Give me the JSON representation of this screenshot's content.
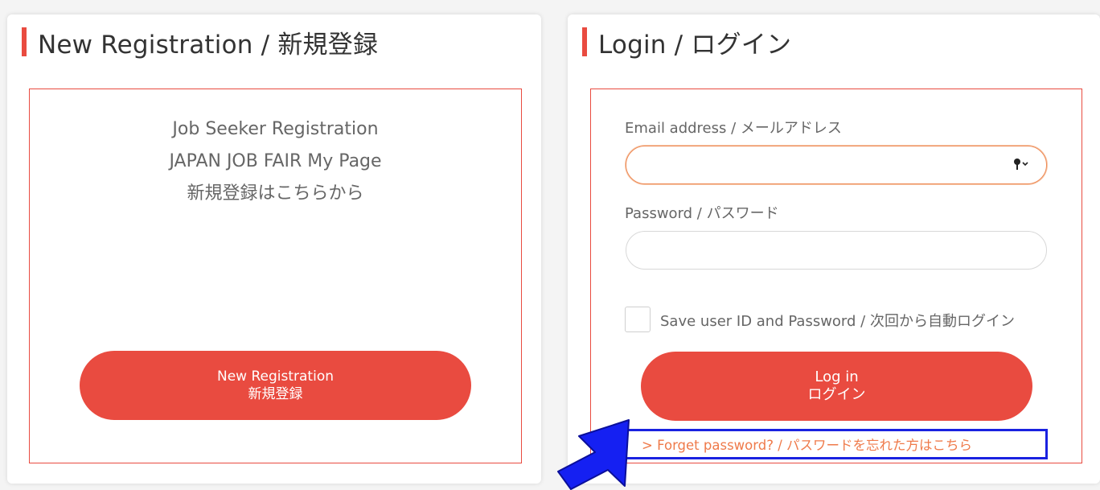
{
  "registration": {
    "title": "New Registration / 新規登録",
    "intro_line1": "Job Seeker Registration",
    "intro_line2": "JAPAN JOB FAIR My Page",
    "intro_line3": "新規登録はこちらから",
    "button_line1": "New Registration",
    "button_line2": "新規登録"
  },
  "login": {
    "title": "Login / ログイン",
    "email_label": "Email address / メールアドレス",
    "email_value": "",
    "password_label": "Password / パスワード",
    "password_value": "",
    "remember_label": "Save user ID and Password / 次回から自動ログイン",
    "remember_checked": false,
    "button_line1": "Log in",
    "button_line2": "ログイン",
    "forgot_link": "> Forget password? / パスワードを忘れた方はこちら"
  },
  "icons": {
    "email_field_icon": "key-icon",
    "pointer": "blue-arrow-icon"
  },
  "colors": {
    "accent": "#e94b40",
    "link": "#ef7a4a",
    "highlight_box": "#1a22e0",
    "focus_border": "#ee8a55"
  }
}
